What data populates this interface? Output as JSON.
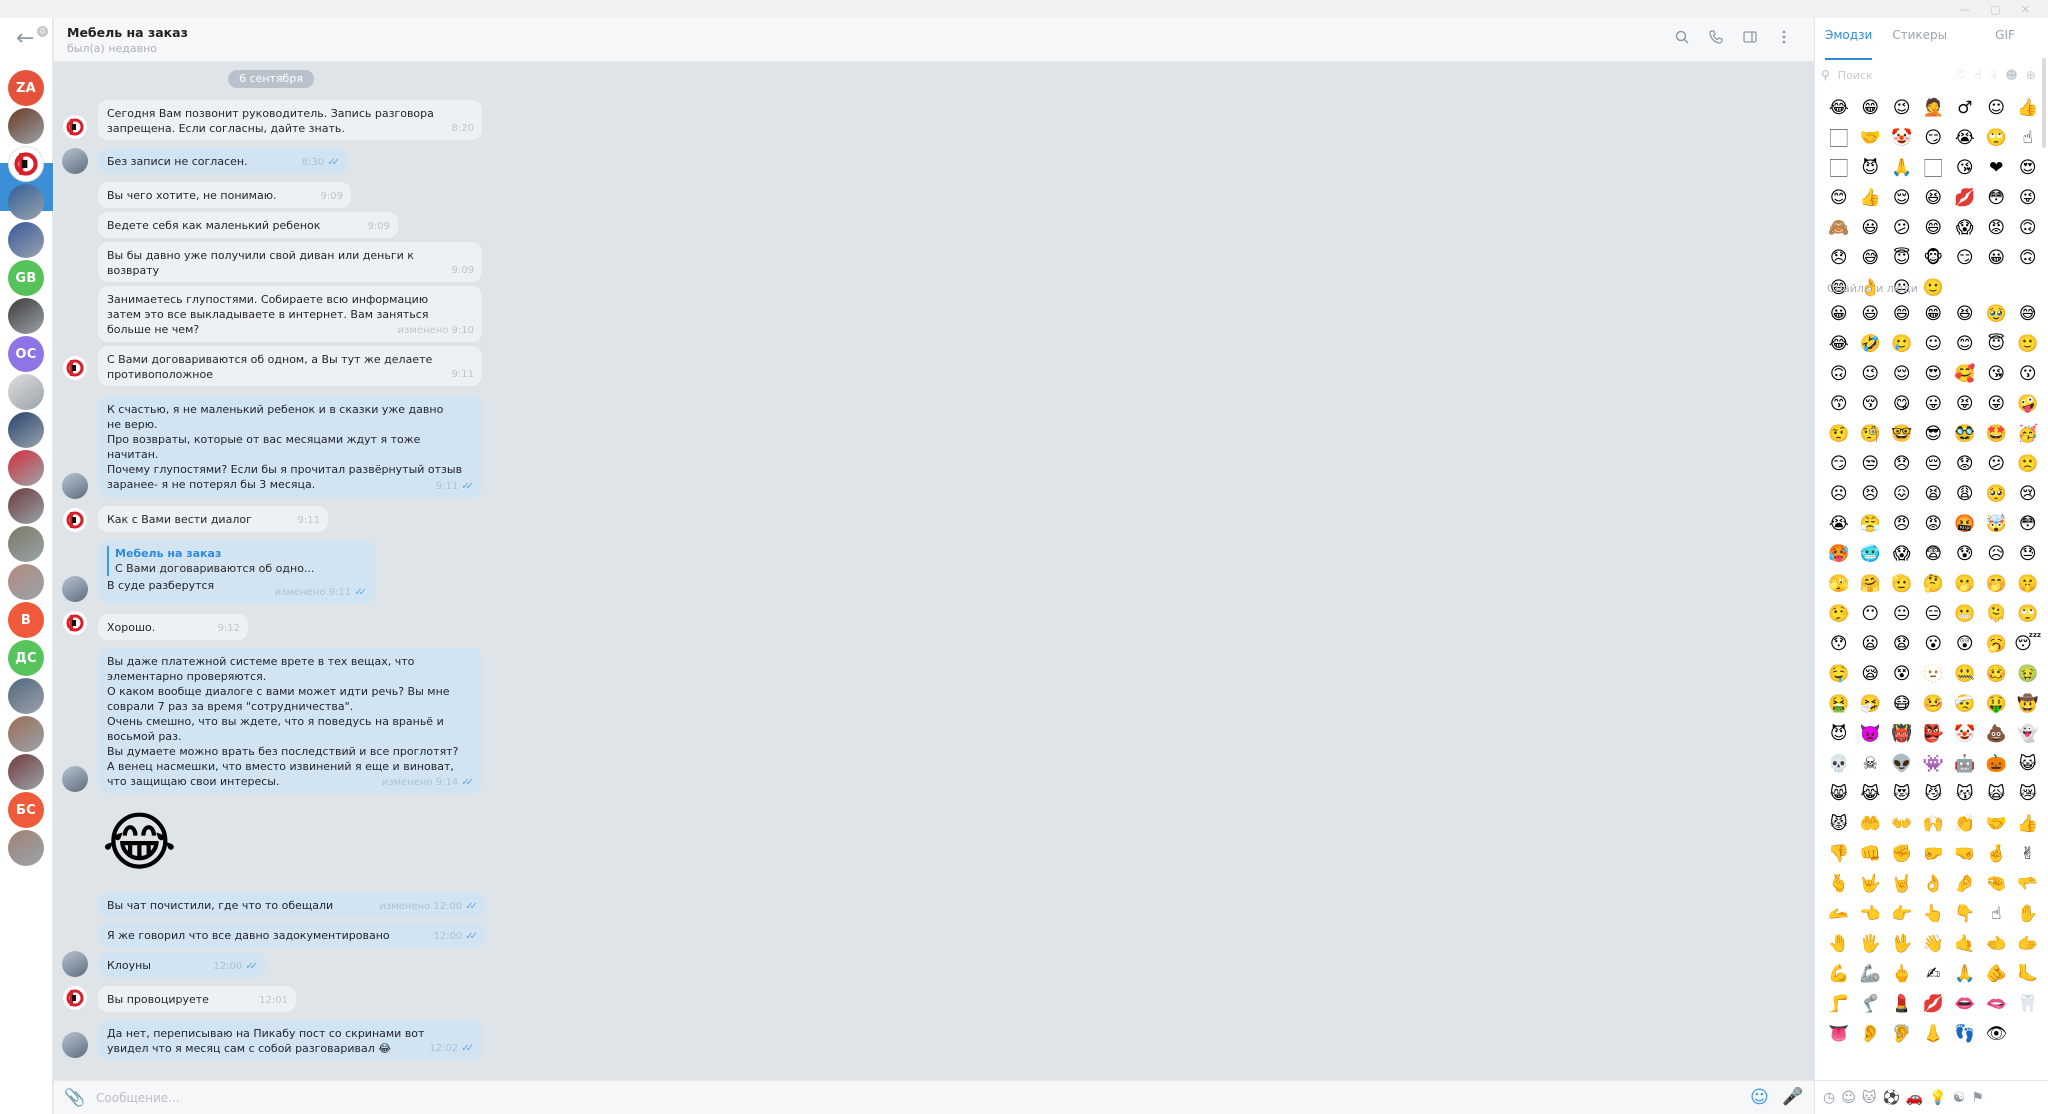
{
  "window": {
    "controls": [
      "—",
      "▢",
      "✕"
    ]
  },
  "sidebar": {
    "back_badge": "0",
    "chats": [
      {
        "initials": "ZA",
        "color": "#e5533d",
        "type": "initials"
      },
      {
        "initials": "",
        "color": "#6b3a22",
        "type": "image"
      },
      {
        "initials": "",
        "color": "#ffffff",
        "type": "logo",
        "active": true
      },
      {
        "initials": "",
        "color": "#2f5d9a",
        "type": "image"
      },
      {
        "initials": "",
        "color": "#38589d",
        "type": "image"
      },
      {
        "initials": "GB",
        "color": "#55c25a",
        "type": "initials"
      },
      {
        "initials": "",
        "color": "#3b3b3b",
        "type": "image"
      },
      {
        "initials": "OC",
        "color": "#8e74e6",
        "type": "initials"
      },
      {
        "initials": "",
        "color": "#dedede",
        "type": "image"
      },
      {
        "initials": "",
        "color": "#27436f",
        "type": "image"
      },
      {
        "initials": "",
        "color": "#d42f3b",
        "type": "image"
      },
      {
        "initials": "",
        "color": "#6c3c3c",
        "type": "image"
      },
      {
        "initials": "",
        "color": "#7a7a62",
        "type": "image"
      },
      {
        "initials": "",
        "color": "#b48a7c",
        "type": "image"
      },
      {
        "initials": "B",
        "color": "#ee5a3a",
        "type": "initials"
      },
      {
        "initials": "ДС",
        "color": "#56c35c",
        "type": "initials"
      },
      {
        "initials": "",
        "color": "#51667d",
        "type": "image"
      },
      {
        "initials": "",
        "color": "#9c6d55",
        "type": "image"
      },
      {
        "initials": "",
        "color": "#733a3a",
        "type": "image"
      },
      {
        "initials": "БС",
        "color": "#ee5a3a",
        "type": "initials"
      },
      {
        "initials": "",
        "color": "#a08272",
        "type": "image"
      }
    ]
  },
  "header": {
    "title": "Мебель на заказ",
    "status": "был(а) недавно",
    "icons": [
      "search-icon",
      "phone-icon",
      "sidebar-toggle-icon",
      "more-icon"
    ]
  },
  "messages": {
    "date": "6 сентября",
    "items": [
      {
        "text": "Сегодня Вам позвонит руководитель. Запись разговора\nзапрещена. Если согласны, дайте знать.",
        "time": "8:20",
        "dir": "in"
      },
      {
        "text": "Без записи не согласен.",
        "time": "8:30",
        "dir": "out"
      },
      {
        "text": "Вы чего хотите, не понимаю.",
        "time": "9:09",
        "dir": "in"
      },
      {
        "text": "Ведете себя как маленький ребенок",
        "time": "9:09",
        "dir": "in"
      },
      {
        "text": "Вы бы давно уже получили свой диван или деньги к\nвозврату",
        "time": "9:09",
        "dir": "in"
      },
      {
        "text": "Занимаетесь глупостями. Собираете всю информацию\nзатем это все выкладываете в интернет. Вам заняться\nбольше не чем?",
        "time": "изменено 9:10",
        "dir": "in"
      },
      {
        "text": "С Вами договариваются об одном, а Вы тут же делаете\nпротивоположное",
        "time": "9:11",
        "dir": "in"
      },
      {
        "text": "К счастью, я не маленький ребенок и в сказки уже давно\nне верю.\nПро возвраты, которые от вас  месяцами ждут я тоже\nначитан.\nПочему глупостями? Если бы я прочитал развёрнутый отзыв\nзаранее- я не потерял бы 3 месяца.",
        "time": "9:11",
        "dir": "out"
      },
      {
        "text": "Как с Вами вести диалог",
        "time": "9:11",
        "dir": "in"
      },
      {
        "reply_name": "Мебель на заказ",
        "reply_text": "С Вами договариваются об одно...",
        "text": "В суде разберутся",
        "time": "изменено 9:11",
        "dir": "out"
      },
      {
        "text": "Хорошо.",
        "time": "9:12",
        "dir": "in"
      },
      {
        "text": "Вы даже платежной системе врете в тех вещах, что\nэлементарно проверяются.\nО каком вообще диалоге с вами может идти речь? Вы мне\nсоврали 7 раз за время \"сотрудничества\".\nОчень смешно, что вы ждете, что я поведусь на враньё и\nвосьмой раз.\nВы думаете можно врать без последствий и все проглотят?\nА венец насмешки, что вместо извинений я еще и виноват,\nчто защищаю свои интересы.",
        "time": "изменено 9:14",
        "dir": "out"
      },
      {
        "text": "😂",
        "time": "",
        "dir": "out"
      },
      {
        "text": "Вы чат почистили, где что то обещали",
        "time": "изменено 12:00",
        "dir": "out"
      },
      {
        "text": "Я же говорил что все давно задокументировано",
        "time": "12:00",
        "dir": "out"
      },
      {
        "text": "Клоуны",
        "time": "12:00",
        "dir": "out"
      },
      {
        "text": "Вы провоцируете",
        "time": "12:01",
        "dir": "in"
      },
      {
        "text": "Да нет, переписываю на Пикабу пост со скринами вот\nувидел что я месяц сам с собой разговаривал 😂",
        "time": "12:02",
        "dir": "out"
      }
    ]
  },
  "composer": {
    "placeholder": "Сообщение..."
  },
  "emoji_panel": {
    "tabs": [
      "Эмодзи",
      "Стикеры",
      "GIF"
    ],
    "search_placeholder": "Поиск",
    "section_title": "Смайлы и люди",
    "recent": "😂😁😉🤦‍♂️☺️👍🏻🤝🤡😏😭🙄☝🏻😈🙏🏻😘❤️😍😊👍😌😆💋😳😜🙈😃😕😄😱😡🙃😞😅😇🐵😏😀🙃😄👌😐🙂",
    "people": "😀😃😄😁😆🥹😅😂🤣🥲☺️😊😇🙂🙃😉😌😍🥰😘😗😙😚😋😛😝😜🤪🤨🧐🤓😎🥸🤩🥳😏😒😞😔😟😕🙁☹️😣😖😫😩🥺😢😭😤😠😡🤬🤯😳🥵🥶😱😨😰😥😓🫣🤗🫡🤔🫢🤭🤫🤥😶😐😑😬🫠🙄😯😦😧😮😲🥱😴🤤😪😵🫥🤐🥴🤢🤮🤧😷🤒🤕🤑🤠😈👿👹👺🤡💩👻💀☠️👽👾🤖🎃😺😸😹😻😼😽🙀😿😾🤲👐🙌👏🤝👍👎👊✊🤛🤜🤞✌️🫰🤟🤘👌🤌🤏🫳🫴👈👉👆👇☝️✋🤚🖐️🖖👋🤙🫲🫱💪🦾🖕✍️🙏🫵🦶🦵🦿💄💋👄🫦🦷👅👂🦻👃👣👁️"
  }
}
